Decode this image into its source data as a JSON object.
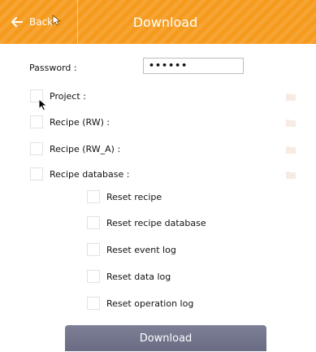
{
  "header": {
    "back_label": "Back",
    "title": "Download",
    "back_icon": "arrow-left-icon",
    "background_color": "#f59a1c"
  },
  "password": {
    "label": "Password :",
    "value": "••••••"
  },
  "items": [
    {
      "label": "Project :",
      "checked": false,
      "icon": "folder-icon"
    },
    {
      "label": "Recipe (RW) :",
      "checked": false,
      "icon": "folder-icon"
    },
    {
      "label": "Recipe (RW_A) :",
      "checked": false,
      "icon": "folder-icon"
    },
    {
      "label": "Recipe database :",
      "checked": false,
      "icon": "folder-icon"
    }
  ],
  "reset_options": [
    {
      "label": "Reset recipe",
      "checked": false
    },
    {
      "label": "Reset recipe database",
      "checked": false
    },
    {
      "label": "Reset event log",
      "checked": false
    },
    {
      "label": "Reset data log",
      "checked": false
    },
    {
      "label": "Reset operation log",
      "checked": false
    }
  ],
  "download_button": {
    "label": "Download",
    "color": "#737590"
  }
}
